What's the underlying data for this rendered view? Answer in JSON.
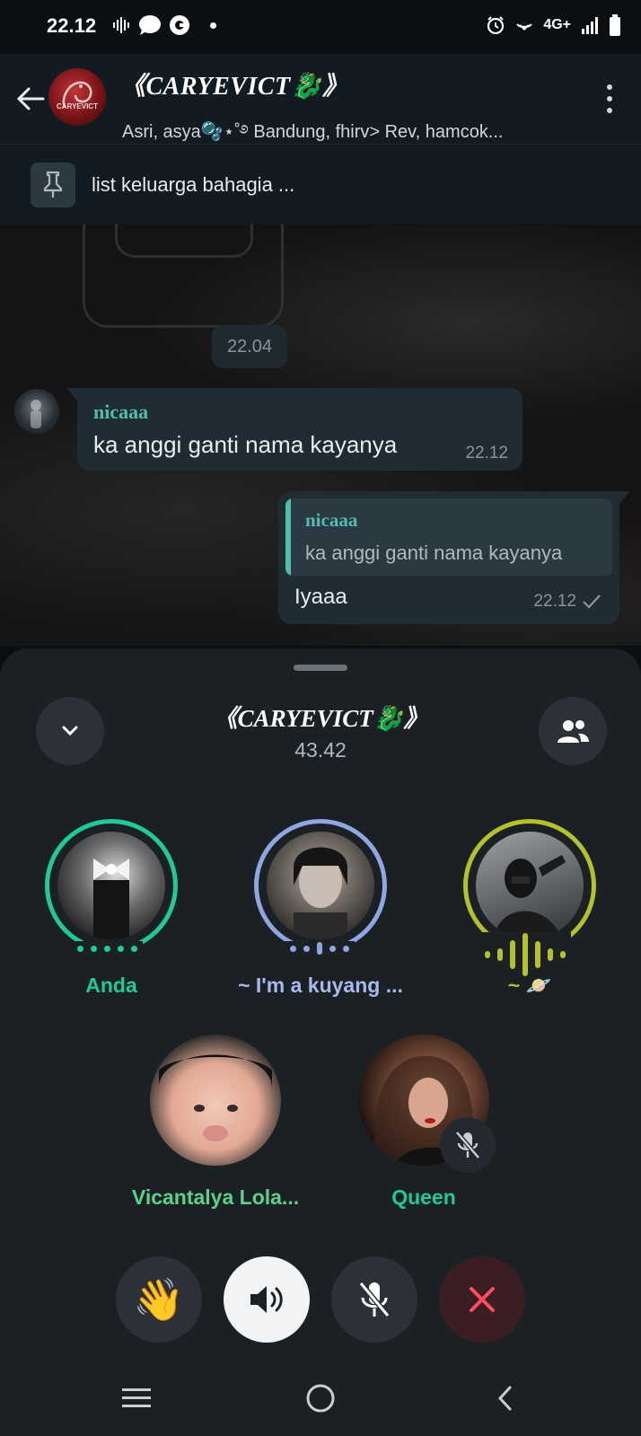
{
  "status_bar": {
    "time": "22.12",
    "network": "4G+",
    "icons": [
      "voice-wave-icon",
      "chat-bubble-icon",
      "g-circle-icon",
      "alarm-icon",
      "hotspot-icon",
      "signal-icon",
      "battery-icon"
    ]
  },
  "header": {
    "title": "《CARYEVICT🐉》",
    "members": "Asri, asya🫧⋆˚࿔ Bandung, fhirv> Rev, hamcok...",
    "avatar_text": "CARYEVICT"
  },
  "pinned": {
    "text": "list keluarga bahagia ..."
  },
  "chat": {
    "date_chip": "22.04",
    "incoming": {
      "sender": "nicaaa",
      "text": "ka anggi ganti nama kayanya",
      "time": "22.12"
    },
    "outgoing": {
      "quote_sender": "nicaaa",
      "quote_text": "ka anggi ganti nama kayanya",
      "text": "Iyaaa",
      "time": "22.12"
    }
  },
  "call": {
    "title": "《CARYEVICT🐉》",
    "duration": "43.42",
    "participants": [
      {
        "name": "Anda",
        "color": "#20c997"
      },
      {
        "name": "~ I'm a kuyang ...",
        "color": "#8fa6e3"
      },
      {
        "name": "~ 🪐",
        "color": "#b5c12a"
      },
      {
        "name": "Vicantalya Lola...",
        "color": "#5fd08a"
      },
      {
        "name": "Queen",
        "color": "#20c997"
      }
    ],
    "actions": {
      "wave": "👋"
    }
  },
  "colors": {
    "accent_green": "#20c997",
    "end_call_red": "#ff4d4d",
    "sheet_bg": "#1b2024"
  }
}
